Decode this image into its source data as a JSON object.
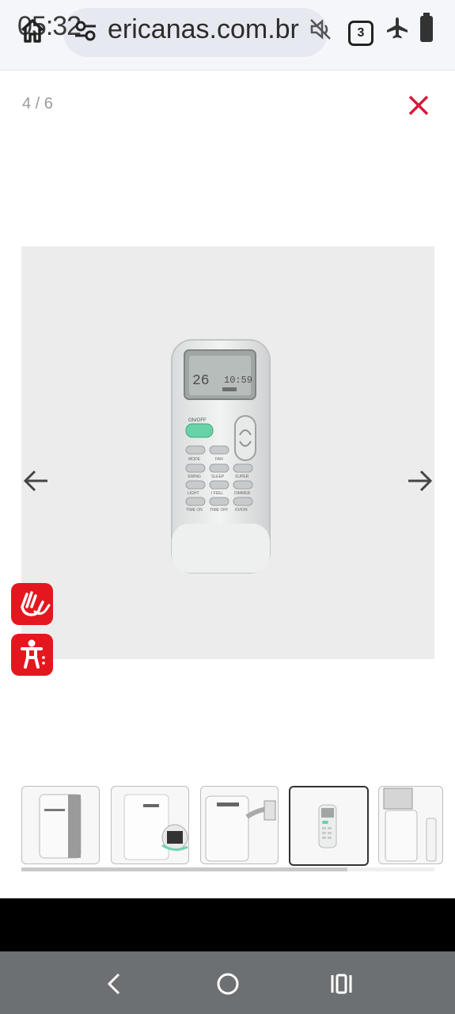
{
  "status_bar": {
    "time": "05:32",
    "tab_count": "3"
  },
  "browser": {
    "url": "ericanas.com.br"
  },
  "gallery": {
    "counter": "4 / 6",
    "current_index": 4,
    "total": 6
  },
  "remote_display": {
    "temperature": "26",
    "clock": "10:59"
  },
  "remote_buttons": {
    "power": "ON/OFF",
    "mode": "MODE",
    "fan": "FAN",
    "swing": "SWING",
    "sleep": "SLEEP",
    "super": "SUPER",
    "light": "LIGHT",
    "ifeel": "I FEEL",
    "dimmer": "DIMMER",
    "timer_on": "TIME ON",
    "timer_off": "TIME OFF",
    "ion": "IO/ION"
  },
  "thumbnails": [
    {
      "alt": "portable air conditioner front view"
    },
    {
      "alt": "air conditioner side with hose"
    },
    {
      "alt": "air conditioner with window kit"
    },
    {
      "alt": "remote control"
    },
    {
      "alt": "air conditioner dimensions"
    }
  ],
  "colors": {
    "accent": "#e4171f",
    "close": "#d61a3c"
  }
}
